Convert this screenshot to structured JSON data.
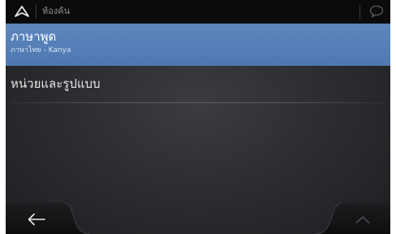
{
  "header": {
    "title": "ห้องค้น",
    "nav_icon": "navigation-arrow-icon",
    "chat_icon": "speech-bubble-icon"
  },
  "menu": {
    "items": [
      {
        "title": "ภาษาพูด",
        "subtitle": "ภาษาไทย - Kanya",
        "selected": true
      },
      {
        "title": "หน่วยและรูปแบบ",
        "selected": false
      }
    ]
  },
  "footer": {
    "back_icon": "back-arrow-icon",
    "up_icon": "chevron-up-icon"
  },
  "colors": {
    "selected_row": "#5d87bd",
    "topbar": "#0b0b0c",
    "background": "#2c2e31",
    "text_primary": "#ffffff",
    "text_dim": "#8f9194"
  }
}
